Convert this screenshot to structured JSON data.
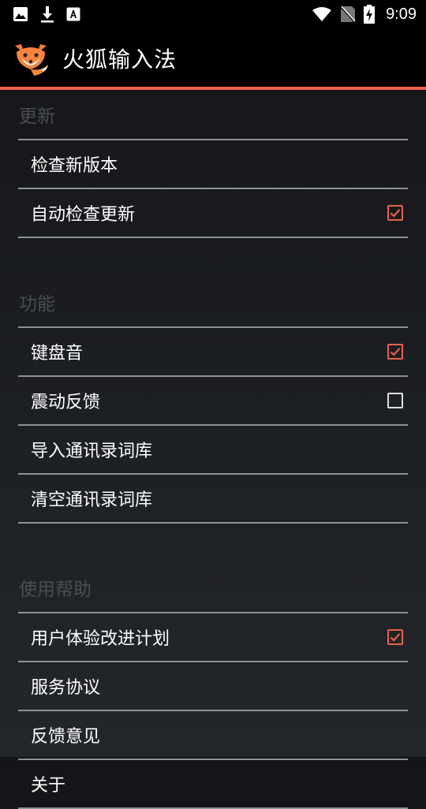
{
  "status_bar": {
    "time": "9:09",
    "icons": [
      "image-icon",
      "download-icon",
      "font-icon",
      "wifi-icon",
      "no-sim-icon",
      "battery-charging-icon"
    ]
  },
  "app_bar": {
    "title": "火狐输入法",
    "logo": "fox-logo"
  },
  "colors": {
    "accent": "#e8614d",
    "header_text": "#4a4d52",
    "divider": "#8e9196"
  },
  "sections": [
    {
      "header": "更新",
      "items": [
        {
          "label": "检查新版本",
          "checkbox": null
        },
        {
          "label": "自动检查更新",
          "checkbox": true
        }
      ]
    },
    {
      "header": "功能",
      "items": [
        {
          "label": "键盘音",
          "checkbox": true
        },
        {
          "label": "震动反馈",
          "checkbox": false
        },
        {
          "label": "导入通讯录词库",
          "checkbox": null
        },
        {
          "label": "清空通讯录词库",
          "checkbox": null
        }
      ]
    },
    {
      "header": "使用帮助",
      "items": [
        {
          "label": "用户体验改进计划",
          "checkbox": true
        },
        {
          "label": "服务协议",
          "checkbox": null
        },
        {
          "label": "反馈意见",
          "checkbox": null
        },
        {
          "label": "关于",
          "checkbox": null
        }
      ]
    }
  ]
}
